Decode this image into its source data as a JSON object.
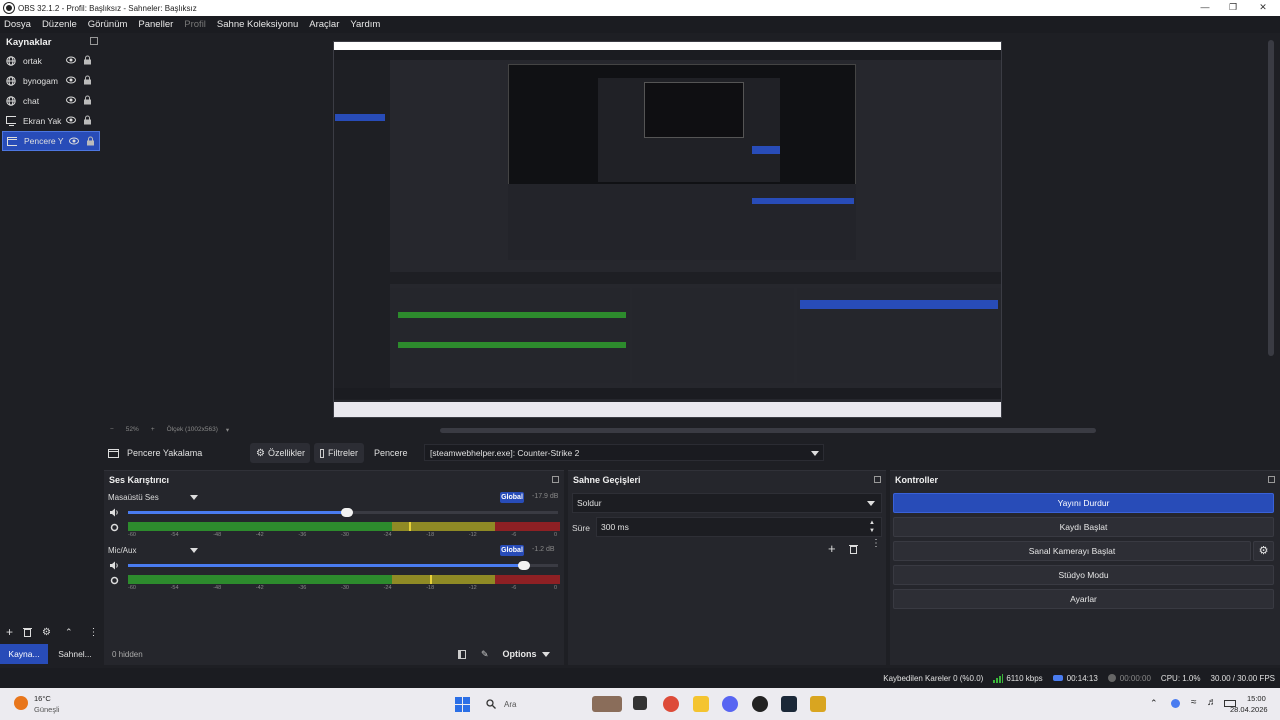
{
  "window": {
    "title": "OBS 32.1.2 - Profil: Başlıksız - Sahneler: Başlıksız"
  },
  "menu": [
    "Dosya",
    "Düzenle",
    "Görünüm",
    "Paneller",
    "Profil",
    "Sahne Koleksiyonu",
    "Araçlar",
    "Yardım"
  ],
  "sources": {
    "title": "Kaynaklar",
    "items": [
      {
        "name": "ortak",
        "icon": "globe-icon"
      },
      {
        "name": "bynogam",
        "icon": "globe-icon"
      },
      {
        "name": "chat",
        "icon": "globe-icon"
      },
      {
        "name": "Ekran Yak",
        "icon": "monitor-icon"
      },
      {
        "name": "Pencere Y",
        "icon": "window-icon",
        "selected": true
      }
    ],
    "tabs": [
      "Kayna...",
      "Sahnel..."
    ]
  },
  "preview": {
    "zoom": "52%",
    "info": "Ölçek (1002x563)"
  },
  "context": {
    "source_name": "Pencere Yakalama",
    "properties": "Özellikler",
    "filters": "Filtreler",
    "window_label": "Pencere",
    "window_value": "[steamwebhelper.exe]: Counter-Strike 2"
  },
  "mixer": {
    "title": "Ses Karıştırıcı",
    "channels": [
      {
        "name": "Masaüstü Ses",
        "badge": "Global",
        "db": "-17.9 dB",
        "volume": 0.51,
        "level": 0.85,
        "peak": 0.65
      },
      {
        "name": "Mic/Aux",
        "badge": "Global",
        "db": "-1.2 dB",
        "volume": 0.92,
        "level": 0.85,
        "peak": 0.7
      }
    ],
    "ticks": [
      "-60",
      "-54",
      "-48",
      "-42",
      "-36",
      "-30",
      "-24",
      "-18",
      "-12",
      "-6",
      "0"
    ],
    "hidden": "0 hidden",
    "options": "Options"
  },
  "transitions": {
    "title": "Sahne Geçişleri",
    "type": "Soldur",
    "duration_label": "Süre",
    "duration": "300 ms"
  },
  "controls": {
    "title": "Kontroller",
    "buttons": [
      "Yayını Durdur",
      "Kaydı Başlat",
      "Sanal Kamerayı Başlat",
      "Stüdyo Modu",
      "Ayarlar"
    ]
  },
  "status": {
    "dropped": "Kaybedilen Kareler 0 (%0.0)",
    "bitrate": "6110 kbps",
    "stream_time": "00:14:13",
    "rec_time": "00:00:00",
    "cpu": "CPU: 1.0%",
    "fps": "30.00 / 30.00 FPS"
  },
  "taskbar": {
    "weather_temp": "16°C",
    "weather_desc": "Güneşli",
    "search": "Ara",
    "time": "15:00",
    "date": "28.04.2026"
  },
  "colors": {
    "accent": "#284cb8",
    "bg": "#1e1f24",
    "dock": "#25262c"
  }
}
